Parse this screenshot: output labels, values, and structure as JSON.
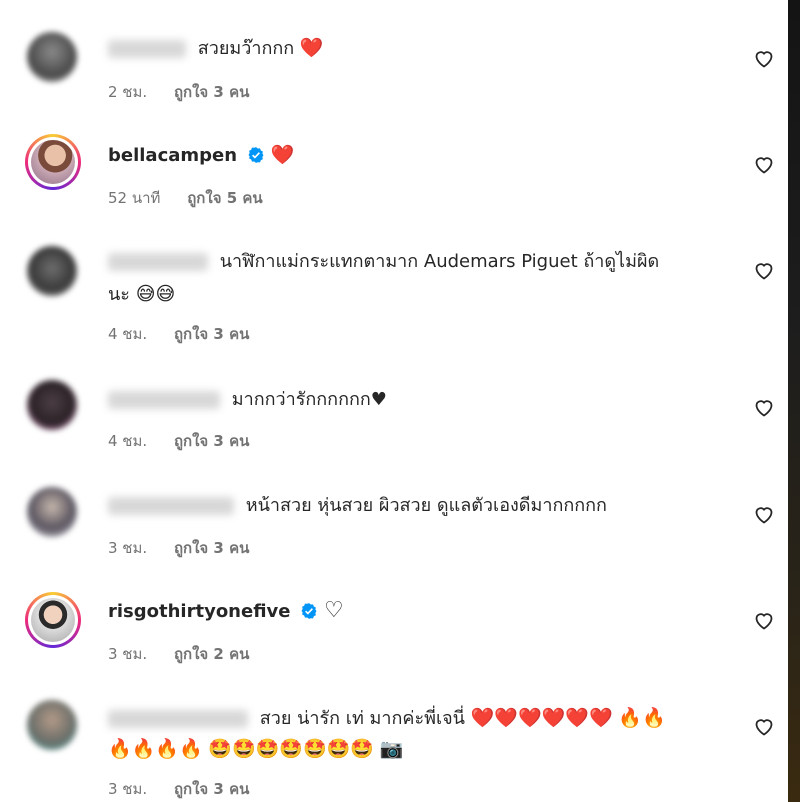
{
  "comments": [
    {
      "text": "สวยมว๊ากกก",
      "emoji": "❤️",
      "time": "2 ชม.",
      "likes": "ถูกใจ 3 คน"
    },
    {
      "username": "bellacampen",
      "emoji": "❤️",
      "time": "52 นาที",
      "likes": "ถูกใจ 5 คน"
    },
    {
      "text": "นาฬิกาแม่กระแทกตามาก Audemars Piguet ถ้าดูไม่ผิด",
      "text2": "นะ",
      "emoji2": "😅😅",
      "time": "4 ชม.",
      "likes": "ถูกใจ 3 คน"
    },
    {
      "text": "มากกว่ารักกกกกก♥",
      "time": "4 ชม.",
      "likes": "ถูกใจ 3 คน"
    },
    {
      "text": "หน้าสวย หุ่นสวย ผิวสวย ดูแลตัวเองดีมากกกกก",
      "time": "3 ชม.",
      "likes": "ถูกใจ 3 คน"
    },
    {
      "username": "risgothirtyonefive",
      "emoji": "♡",
      "time": "3 ชม.",
      "likes": "ถูกใจ 2 คน"
    },
    {
      "text": "สวย น่ารัก เท่ มากค่ะพี่เจนี่",
      "hearts": "❤️❤️❤️❤️❤️❤️",
      "fires1": "🔥🔥",
      "fires2": "🔥🔥🔥🔥",
      "stars": "🤩🤩🤩🤩🤩🤩🤩",
      "camera": "📷",
      "time": "3 ชม.",
      "likes": "ถูกใจ 3 คน"
    }
  ],
  "colors": {
    "text": "#262626",
    "meta": "#737373",
    "verified": "#0095f6",
    "heart_red": "#e41e3f"
  },
  "icons": {
    "like": "heart-outline-icon",
    "verified": "verified-badge-icon"
  }
}
